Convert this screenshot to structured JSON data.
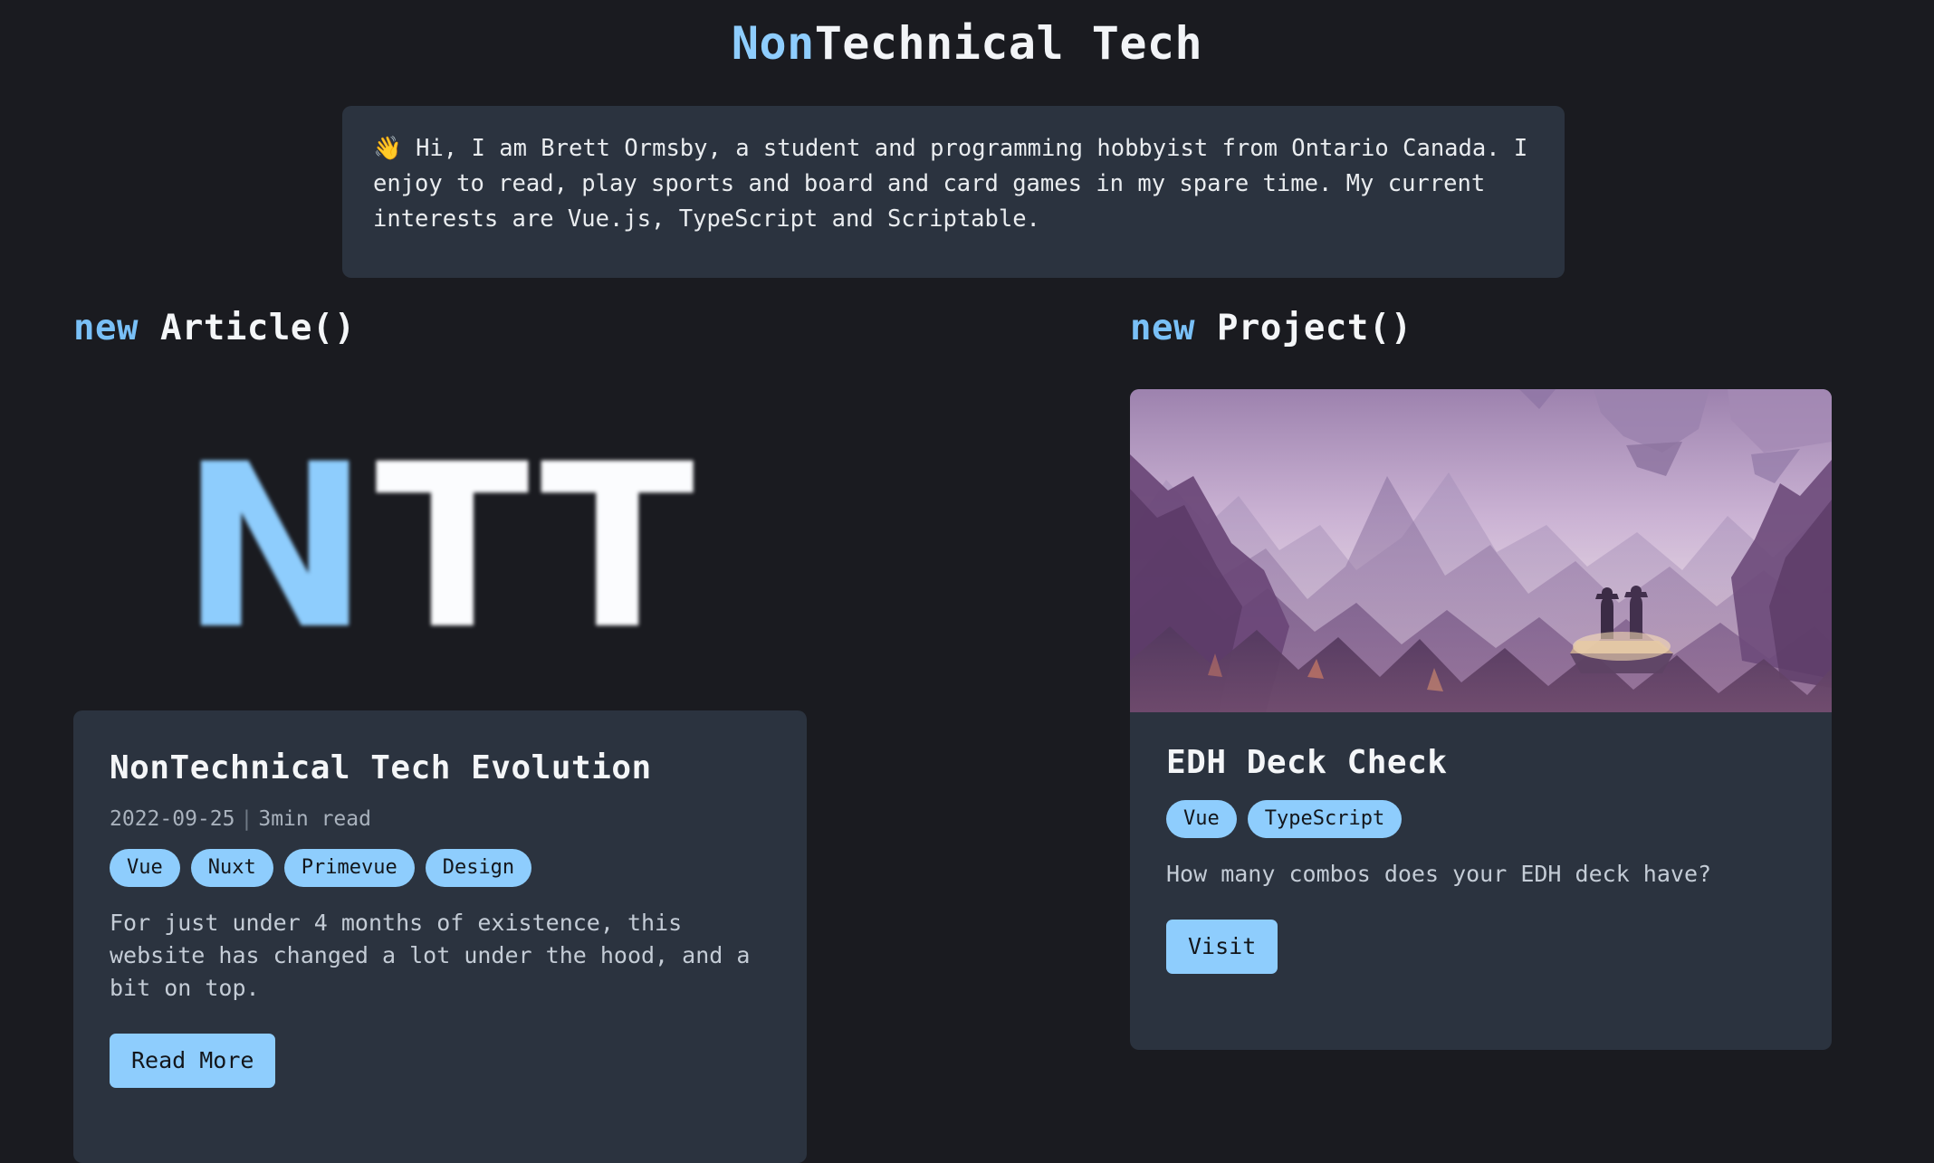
{
  "site": {
    "title_accent": "Non",
    "title_rest": "Technical Tech"
  },
  "bio": {
    "text": "👋 Hi, I am Brett Ormsby, a student and programming hobbyist from Ontario Canada. I enjoy to read, play sports and board and card games in my spare time. My current interests are Vue.js, TypeScript and Scriptable."
  },
  "article_section": {
    "heading_keyword": "new",
    "heading_name": "Article()",
    "logo": {
      "accent_letter": "N",
      "rest_letters": "TT"
    },
    "card": {
      "title": "NonTechnical Tech Evolution",
      "date": "2022-09-25",
      "separator": "|",
      "read_time": "3min read",
      "tags": [
        "Vue",
        "Nuxt",
        "Primevue",
        "Design"
      ],
      "description": "For just under 4 months of existence, this website has changed a lot under the hood, and a bit on top.",
      "button_label": "Read More"
    }
  },
  "project_section": {
    "heading_keyword": "new",
    "heading_name": "Project()",
    "card": {
      "image_alt": "purple mountain landscape with two figures on a cliff",
      "title": "EDH Deck Check",
      "tags": [
        "Vue",
        "TypeScript"
      ],
      "description": "How many combos does your EDH deck have?",
      "button_label": "Visit"
    }
  },
  "colors": {
    "background": "#1a1b20",
    "surface": "#2b333f",
    "accent": "#8ecdfd",
    "accent_heading": "#79c0f7",
    "text_primary": "#f4f6f8",
    "text_secondary": "#c4ccd6",
    "text_muted": "#a9b2bd",
    "tag_text": "#13161b"
  }
}
